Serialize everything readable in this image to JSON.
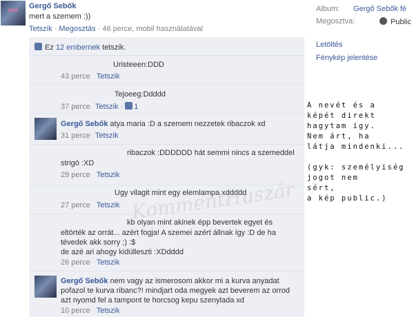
{
  "post": {
    "author": "Gergő Sebők",
    "text": "mert a szemem :))",
    "like": "Tetszik",
    "share": "Megosztás",
    "meta": "46 perce, mobil használatával",
    "avatar_label": "KISS"
  },
  "likes": {
    "prefix": "Ez",
    "count_link": "12 embernek",
    "suffix": " tetszik."
  },
  "comments": [
    {
      "text": "Uristeeen:DDD",
      "time": "43 perce",
      "like": "Tetszik"
    },
    {
      "text": "Tejoeeg:Ddddd",
      "time": "37 perce",
      "like": "Tetszik",
      "likes": "1"
    },
    {
      "author": "Gergő Sebők",
      "text": "atya maria :D a szemem nezzetek ribaczok xd",
      "time": "31 perce",
      "like": "Tetszik"
    },
    {
      "text1": "ribaczok :DDDDDD hát semmi nincs a szemeddel",
      "text2": "strigó :XD",
      "time": "29 perce",
      "like": "Tetszik"
    },
    {
      "text": "Ugy vilagit mint egy elemlampa xddddd",
      "time": "27 perce",
      "like": "Tetszik"
    },
    {
      "text1": "kb olyan mint akinek épp bevertek egyet és",
      "text2": "eltörték az orrát... azért fogja! A szemei azért állnak így :D de ha",
      "text3": "tévedek akk sorry ;) :$",
      "text4": "de azé ari ahogy kidülleszti :XDdddd",
      "time": "26 perce",
      "like": "Tetszik"
    },
    {
      "author": "Gergő Sebők",
      "text1": "nem vagy az ismerosom akkor mi a kurva anyadat",
      "text2": "pofazol te kurva ribanc?! mindjart oda megyek azt beverem az orrod",
      "text3": "azt nyomd fel a tampont te horcsog kepu szenylada xd",
      "time": "10 perce",
      "like": "Tetszik"
    }
  ],
  "sidebar": {
    "album_label": "Album:",
    "album_value": "Gergő Sebők fé",
    "shared_label": "Megosztva:",
    "shared_value": "Public",
    "download": "Letöltés",
    "report": "Fénykép jelentése"
  },
  "watermark": "KommentHuszár",
  "note": {
    "line1": "A nevét és a",
    "line2": "képét direkt",
    "line3": "hagytam így.",
    "line4": "Nem árt, ha",
    "line5": "látja mindenki...",
    "line6": "(gyk: személyiség",
    "line7": "jogot nem",
    "line8": "sért,",
    "line9": "a kép public.)"
  }
}
